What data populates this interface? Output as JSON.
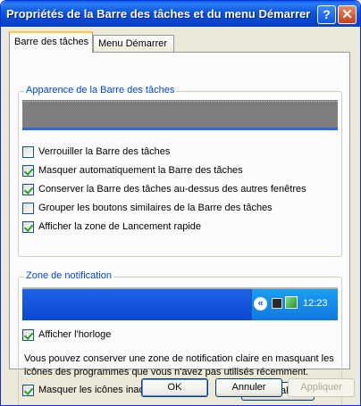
{
  "window": {
    "title": "Propriétés de la Barre des tâches et du menu Démarrer"
  },
  "tabs": [
    {
      "label": "Barre des tâches",
      "active": true
    },
    {
      "label": "Menu Démarrer",
      "active": false
    }
  ],
  "appearance": {
    "title": "Apparence de la Barre des tâches",
    "options": [
      {
        "label": "Verrouiller la Barre des tâches",
        "checked": false
      },
      {
        "label": "Masquer automatiquement la Barre des tâches",
        "checked": true
      },
      {
        "label": "Conserver la Barre des tâches au-dessus des autres fenêtres",
        "checked": true
      },
      {
        "label": "Grouper les boutons similaires de la Barre des tâches",
        "checked": false
      },
      {
        "label": "Afficher la zone de Lancement rapide",
        "checked": true
      }
    ]
  },
  "notification": {
    "title": "Zone de notification",
    "clock_preview": "12:23",
    "tray_icons": [
      "chevron-left-icon",
      "speaker-icon",
      "network-icon"
    ],
    "show_clock": {
      "label": "Afficher l'horloge",
      "checked": true
    },
    "description": "Vous pouvez conserver une zone de notification claire en masquant les icônes des programmes que vous n'avez pas utilisés récemment.",
    "hide_inactive": {
      "label": "Masquer les icônes inactives",
      "checked": true
    },
    "customize_button": "Personnaliser..."
  },
  "footer": {
    "ok": "OK",
    "cancel": "Annuler",
    "apply": "Appliquer"
  },
  "colors": {
    "titlebar": "#0a54e0",
    "group_title": "#0046d5",
    "check": "#21a121"
  }
}
